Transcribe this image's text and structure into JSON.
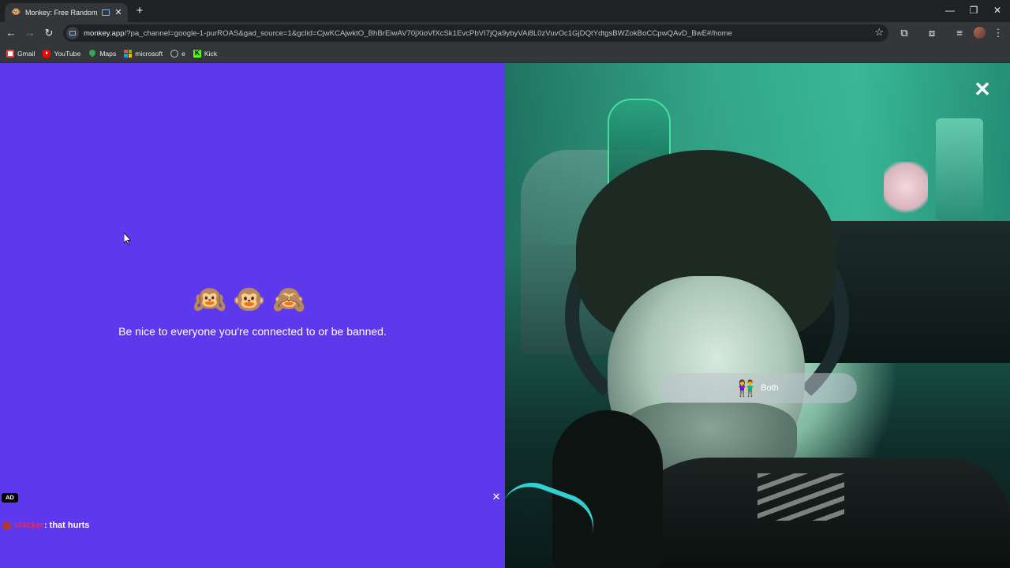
{
  "browser": {
    "tab": {
      "title": "Monkey: Free Random Vide",
      "favicon": "🐵",
      "close_icon": "✕"
    },
    "new_tab_icon": "+",
    "window_controls": {
      "minimize": "—",
      "maximize": "❐",
      "close": "✕"
    },
    "toolbar": {
      "back_icon": "←",
      "forward_icon": "→",
      "reload_icon": "↻",
      "url_host": "monkey.app",
      "url_rest": "/?pa_channel=google-1-purROAS&gad_source=1&gclid=CjwKCAjwktO_BhBrEiwAV70jXioVfXcSk1EvcPbVI7jQa9ybyVAi8L0zVuvOc1GjDQtYdtgsBWZokBoCCpwQAvD_BwE#/home",
      "bookmark_star_icon": "☆",
      "extensions_icon": "⧉",
      "cast_icon": "⧈",
      "media_icon": "≡",
      "menu_icon": "⋮"
    },
    "bookmarks": [
      {
        "label": "Gmail",
        "icon": "gmail-icon"
      },
      {
        "label": "YouTube",
        "icon": "youtube-icon"
      },
      {
        "label": "Maps",
        "icon": "maps-icon"
      },
      {
        "label": "microsoft",
        "icon": "microsoft-icon"
      },
      {
        "label": "e",
        "icon": "globe-icon"
      },
      {
        "label": "Kick",
        "icon": "kick-icon"
      }
    ]
  },
  "page": {
    "emojis": "🙉🐵🙈",
    "notice": "Be nice to everyone you're connected to or be banned.",
    "ad_badge": "AD",
    "ad_close": "✕",
    "chat": {
      "username": "sl4cker",
      "message": " : that hurts"
    },
    "video_close": "✕",
    "gender_filter": {
      "emoji": "👫",
      "label": "Both"
    }
  },
  "colors": {
    "left_panel_bg": "#5e38ec",
    "chat_username": "#e6285a",
    "browser_frame": "#35363a"
  }
}
